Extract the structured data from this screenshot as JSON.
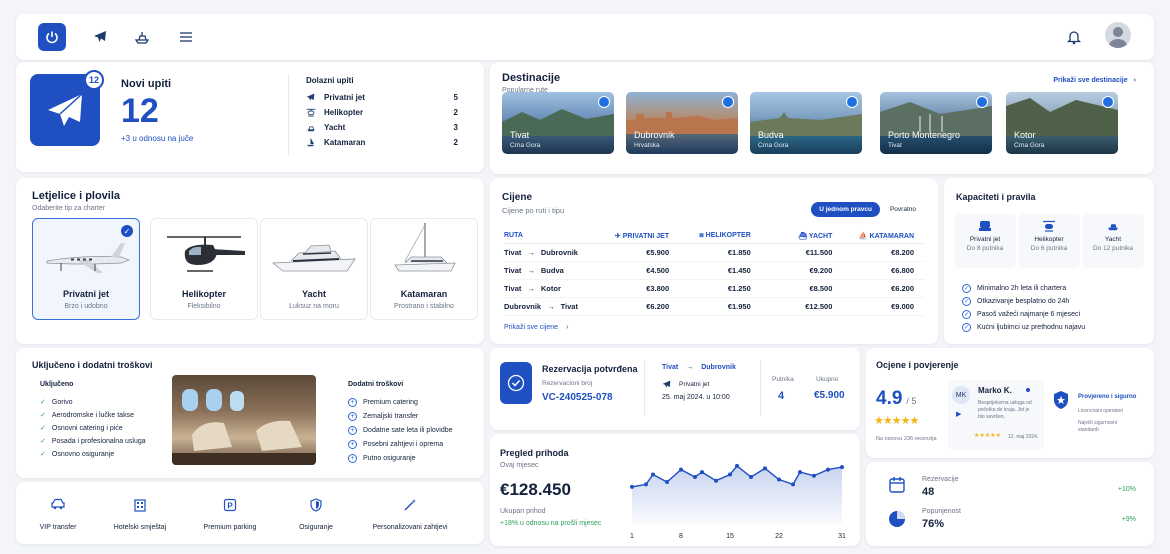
{
  "hero": {
    "title": "Novi upiti",
    "count": "12",
    "badge": "12",
    "delta": "+3 u odnosu na juče",
    "incoming_title": "Dolazni upiti",
    "incoming": [
      {
        "icon": "plane-icon",
        "label": "Privatni jet",
        "value": "5"
      },
      {
        "icon": "helicopter-icon",
        "label": "Helikopter",
        "value": "2"
      },
      {
        "icon": "yacht-icon",
        "label": "Yacht",
        "value": "3"
      },
      {
        "icon": "sailboat-icon",
        "label": "Katamaran",
        "value": "2"
      }
    ]
  },
  "destinations": {
    "title": "Destinacije",
    "subtitle": "Popularne rute",
    "link": "Prikaži sve destinacije",
    "items": [
      {
        "name": "Tivat",
        "country": "Crna Gora"
      },
      {
        "name": "Dubrovnik",
        "country": "Hrvatska"
      },
      {
        "name": "Budva",
        "country": "Crna Gora"
      },
      {
        "name": "Porto Montenegro",
        "country": "Tivat"
      },
      {
        "name": "Kotor",
        "country": "Crna Gora"
      }
    ]
  },
  "vehicles": {
    "title": "Letjelice i plovila",
    "subtitle": "Odaberite tip za charter",
    "items": [
      {
        "name": "Privatni jet",
        "sub": "Brzo i udobno"
      },
      {
        "name": "Helikopter",
        "sub": "Fleksibilno"
      },
      {
        "name": "Yacht",
        "sub": "Luksuz na moru"
      },
      {
        "name": "Katamaran",
        "sub": "Prostrano i stabilno"
      }
    ]
  },
  "prices": {
    "title": "Cijene",
    "subtitle": "Cijene po ruti i tipu",
    "toggle_active": "U jednom pravcu",
    "toggle_other": "Povratno",
    "headers": [
      "RUTA",
      "PRIVATNI JET",
      "HELIKOPTER",
      "YACHT",
      "KATAMARAN"
    ],
    "rows": [
      {
        "from": "Tivat",
        "to": "Dubrovnik",
        "jet": "€5.900",
        "heli": "€1.850",
        "yacht": "€11.500",
        "kat": "€8.200"
      },
      {
        "from": "Tivat",
        "to": "Budva",
        "jet": "€4.500",
        "heli": "€1.450",
        "yacht": "€9.200",
        "kat": "€6.800"
      },
      {
        "from": "Tivat",
        "to": "Kotor",
        "jet": "€3.800",
        "heli": "€1.250",
        "yacht": "€8.500",
        "kat": "€6.200"
      },
      {
        "from": "Dubrovnik",
        "to": "Tivat",
        "jet": "€6.200",
        "heli": "€1.950",
        "yacht": "€12.500",
        "kat": "€9.000"
      }
    ],
    "link": "Prikaži sve cijene"
  },
  "capacity": {
    "title": "Kapaciteti i pravila",
    "items": [
      {
        "name": "Privatni jet",
        "sub": "Do 8 putnika"
      },
      {
        "name": "Helikopter",
        "sub": "Do 6 putnika"
      },
      {
        "name": "Yacht",
        "sub": "Do 12 putnika"
      }
    ],
    "rules": [
      "Minimalno 2h leta ili chartera",
      "Otkazivanje besplatno do 24h",
      "Pasoš važeći najmanje 6 mjeseci",
      "Kućni ljubimci uz prethodnu najavu"
    ]
  },
  "included": {
    "title": "Uključeno i dodatni troškovi",
    "included_title": "Uključeno",
    "included_items": [
      "Gorivo",
      "Aerodromske i lučke takse",
      "Osnovni catering i piće",
      "Posada i profesionalna usluga",
      "Osnovno osiguranje"
    ],
    "extra_title": "Dodatni troškovi",
    "extra_items": [
      "Premium catering",
      "Zemaljski transfer",
      "Dodatne sate leta ili plovidbe",
      "Posebni zahtjevi i oprema",
      "Putno osiguranje"
    ]
  },
  "services": [
    {
      "icon": "car-icon",
      "label": "VIP transfer"
    },
    {
      "icon": "hotel-icon",
      "label": "Hotelski smještaj"
    },
    {
      "icon": "parking-icon",
      "label": "Premium parking"
    },
    {
      "icon": "shield-icon",
      "label": "Osiguranje"
    },
    {
      "icon": "wand-icon",
      "label": "Personalizovani zahtjevi"
    }
  ],
  "booking": {
    "title": "Rezervacija potvrđena",
    "ref_label": "Rezervacioni broj",
    "ref": "VC-240525-078",
    "from": "Tivat",
    "to": "Dubrovnik",
    "type": "Privatni jet",
    "date": "25. maj 2024. u 10:00",
    "pax_label": "Putnika",
    "pax": "4",
    "total_label": "Ukupno",
    "total": "€5.900"
  },
  "revenue": {
    "title": "Pregled prihoda",
    "period": "Ovaj mjesec",
    "amount": "€128.450",
    "amount_label": "Ukupan prihod",
    "delta": "+18% u odnosu na prošli mjesec"
  },
  "chart_data": {
    "type": "area",
    "x": [
      1,
      3,
      4,
      6,
      8,
      10,
      11,
      13,
      15,
      16,
      18,
      20,
      22,
      24,
      25,
      27,
      29,
      31
    ],
    "y": [
      30,
      32,
      40,
      34,
      44,
      38,
      42,
      35,
      40,
      47,
      38,
      45,
      36,
      32,
      42,
      39,
      44,
      46
    ],
    "x_ticks": [
      "1",
      "8",
      "15",
      "22",
      "31"
    ]
  },
  "ratings": {
    "title": "Ocjene i povjerenje",
    "score": "4.9",
    "out_of": "/ 5",
    "stars": 5,
    "count": "Na osnovu 236 recenzija",
    "review_initials": "MK",
    "review_name": "Marko K.",
    "review_text_1": "Besprijekorna usluga od",
    "review_text_2": "početka do kraja. Jet je",
    "review_text_3": "bio savršen,",
    "review_date": "12. maj 2024.",
    "review_stars": 5,
    "trust_title": "Provjereno i sigurno",
    "trust_1": "Licencirani operateri",
    "trust_2": "Najviši sigurnosni",
    "trust_3": "standardi"
  },
  "stats": [
    {
      "label": "Rezervacije",
      "value": "48",
      "delta": "+10%"
    },
    {
      "label": "Popunjenost",
      "value": "76%",
      "delta": "+9%"
    }
  ],
  "colors": {
    "accent": "#1f4fc1",
    "green": "#2f9e5a",
    "star": "#f2b515"
  }
}
